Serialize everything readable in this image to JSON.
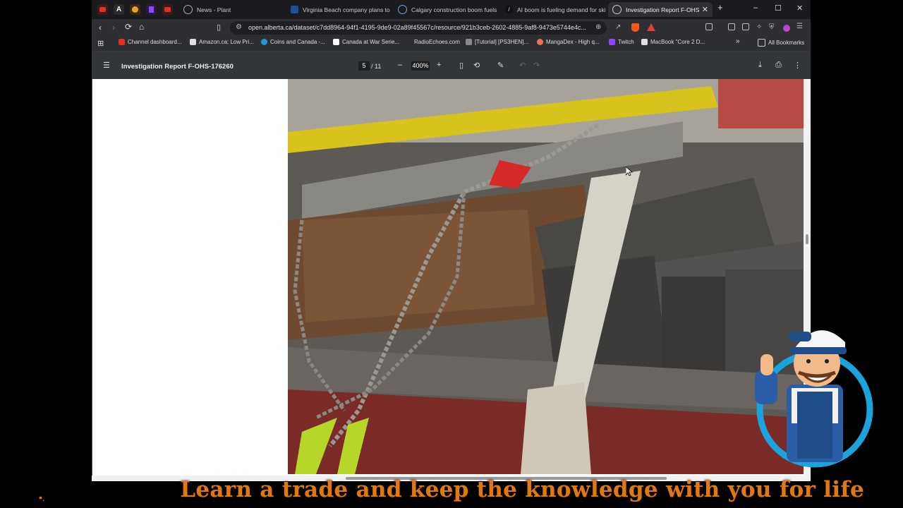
{
  "tabs": [
    {
      "label": "News - Plant"
    },
    {
      "label": "Virginia Beach company plans to"
    },
    {
      "label": "Calgary construction boom fuels"
    },
    {
      "label": "AI boom is fueling demand for ski"
    },
    {
      "label": "Investigation Report F-OHS-"
    }
  ],
  "new_tab": "+",
  "window": {
    "minimize": "–",
    "maximize": "☐",
    "close": "✕"
  },
  "address": {
    "url": "open.alberta.ca/dataset/c7dd8964-94f1-4195-9de9-02a89f45567c/resource/921b3ceb-2602-4885-9af8-9473e5744e4c..."
  },
  "bookmarks": [
    {
      "label": "Channel dashboard...",
      "color": "#e52d27"
    },
    {
      "label": "Amazon.ca: Low Pri...",
      "color": "#dddddd"
    },
    {
      "label": "Coins and Canada -...",
      "color": "#1a9bd7"
    },
    {
      "label": "Canada at War Serie...",
      "color": "#ffffff"
    },
    {
      "label": "RadioEchoes.com",
      "color": "#2e2f33"
    },
    {
      "label": "[Tutorial] [PS3HEN]...",
      "color": "#888888"
    },
    {
      "label": "MangaDex - High q...",
      "color": "#f26d5b"
    },
    {
      "label": "Twitch",
      "color": "#9146ff"
    },
    {
      "label": "MacBook \"Core 2 D...",
      "color": "#dddddd"
    }
  ],
  "bookmarks_overflow": "»",
  "all_bookmarks": "All Bookmarks",
  "pdf": {
    "title": "Investigation Report F-OHS-176260",
    "page_current": "5",
    "page_total": "/ 11",
    "zoom": "400%",
    "zoom_out": "–",
    "zoom_in": "+"
  },
  "banner": {
    "text": "Learn a trade and keep the knowledge with you for life",
    "dots": "•."
  }
}
